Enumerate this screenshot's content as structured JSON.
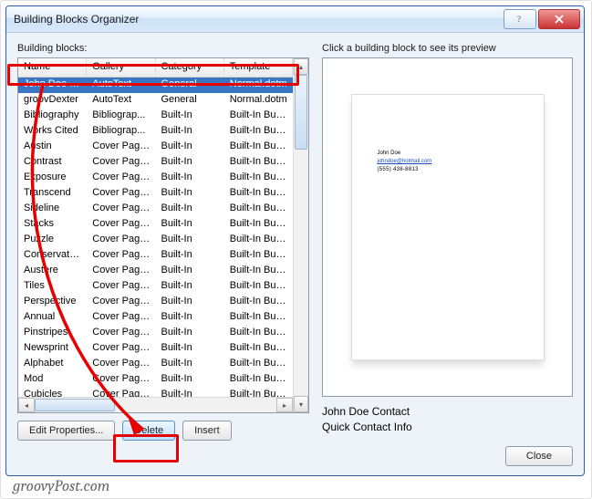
{
  "window": {
    "title": "Building Blocks Organizer"
  },
  "leftLabel": "Building blocks:",
  "rightLabel": "Click a building block to see its preview",
  "columns": [
    "Name",
    "Gallery",
    "Category",
    "Template"
  ],
  "rows": [
    {
      "name": "John Doe C...",
      "gallery": "AutoText",
      "category": "General",
      "template": "Normal.dotm",
      "selected": true
    },
    {
      "name": "groovDexter",
      "gallery": "AutoText",
      "category": "General",
      "template": "Normal.dotm"
    },
    {
      "name": "Bibliography",
      "gallery": "Bibliograp...",
      "category": "Built-In",
      "template": "Built-In Buil..."
    },
    {
      "name": "Works Cited",
      "gallery": "Bibliograp...",
      "category": "Built-In",
      "template": "Built-In Buil..."
    },
    {
      "name": "Austin",
      "gallery": "Cover Pages",
      "category": "Built-In",
      "template": "Built-In Buil..."
    },
    {
      "name": "Contrast",
      "gallery": "Cover Pages",
      "category": "Built-In",
      "template": "Built-In Buil..."
    },
    {
      "name": "Exposure",
      "gallery": "Cover Pages",
      "category": "Built-In",
      "template": "Built-In Buil..."
    },
    {
      "name": "Transcend",
      "gallery": "Cover Pages",
      "category": "Built-In",
      "template": "Built-In Buil..."
    },
    {
      "name": "Sideline",
      "gallery": "Cover Pages",
      "category": "Built-In",
      "template": "Built-In Buil..."
    },
    {
      "name": "Stacks",
      "gallery": "Cover Pages",
      "category": "Built-In",
      "template": "Built-In Buil..."
    },
    {
      "name": "Puzzle",
      "gallery": "Cover Pages",
      "category": "Built-In",
      "template": "Built-In Buil..."
    },
    {
      "name": "Conservative",
      "gallery": "Cover Pages",
      "category": "Built-In",
      "template": "Built-In Buil..."
    },
    {
      "name": "Austere",
      "gallery": "Cover Pages",
      "category": "Built-In",
      "template": "Built-In Buil..."
    },
    {
      "name": "Tiles",
      "gallery": "Cover Pages",
      "category": "Built-In",
      "template": "Built-In Buil..."
    },
    {
      "name": "Perspective",
      "gallery": "Cover Pages",
      "category": "Built-In",
      "template": "Built-In Buil..."
    },
    {
      "name": "Annual",
      "gallery": "Cover Pages",
      "category": "Built-In",
      "template": "Built-In Buil..."
    },
    {
      "name": "Pinstripes",
      "gallery": "Cover Pages",
      "category": "Built-In",
      "template": "Built-In Buil..."
    },
    {
      "name": "Newsprint",
      "gallery": "Cover Pages",
      "category": "Built-In",
      "template": "Built-In Buil..."
    },
    {
      "name": "Alphabet",
      "gallery": "Cover Pages",
      "category": "Built-In",
      "template": "Built-In Buil..."
    },
    {
      "name": "Mod",
      "gallery": "Cover Pages",
      "category": "Built-In",
      "template": "Built-In Buil..."
    },
    {
      "name": "Cubicles",
      "gallery": "Cover Pages",
      "category": "Built-In",
      "template": "Built-In Buil..."
    }
  ],
  "buttons": {
    "editProperties": "Edit Properties...",
    "delete": "Delete",
    "insert": "Insert",
    "close": "Close"
  },
  "preview": {
    "line1": "John Doe",
    "line2": "johndoe@hotmail.com",
    "line3": "(555) 438-8813"
  },
  "meta": {
    "name": "John Doe Contact",
    "desc": "Quick Contact Info"
  },
  "watermark": "groovyPost.com"
}
